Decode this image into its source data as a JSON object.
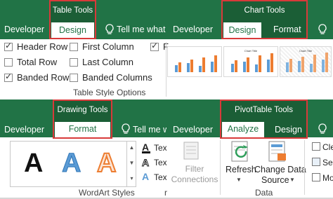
{
  "table_tools": {
    "context_title": "Table Tools",
    "tabs": {
      "left": "Developer",
      "active": "Design"
    },
    "tell_me": "Tell me what y",
    "options": {
      "col1": [
        {
          "label": "Header Row",
          "checked": true
        },
        {
          "label": "Total Row",
          "checked": false
        },
        {
          "label": "Banded Rows",
          "checked": true
        }
      ],
      "col2": [
        {
          "label": "First Column",
          "checked": false
        },
        {
          "label": "Last Column",
          "checked": false
        },
        {
          "label": "Banded Columns",
          "checked": false
        }
      ],
      "col3_partial": {
        "label": "F",
        "checked": true
      }
    },
    "group_label": "Table Style Options"
  },
  "chart_tools": {
    "context_title": "Chart Tools",
    "tabs": {
      "left": "Developer",
      "active": "Design",
      "right": "Format"
    },
    "style_thumbnails": [
      {
        "title": "",
        "style": "plain"
      },
      {
        "title": "Chart Title",
        "style": "plain"
      },
      {
        "title": "Chart Title",
        "style": "striped"
      }
    ]
  },
  "drawing_tools": {
    "context_title": "Drawing Tools",
    "tabs": {
      "left": "Developer",
      "active": "Format"
    },
    "tell_me": "Tell me w",
    "wordart_samples": [
      "A",
      "A",
      "A"
    ],
    "text_buttons": [
      "Tex",
      "Tex",
      "Tex"
    ],
    "group_label": "WordArt Styles",
    "group_label_partial": "er",
    "filter_connections": "Filter Connections"
  },
  "pivottable_tools": {
    "context_title": "PivotTable Tools",
    "tabs": {
      "left": "Developer",
      "active": "Analyze",
      "right": "Design"
    },
    "refresh_label": "Refresh",
    "change_source_line1": "Change Data",
    "change_source_line2": "Source",
    "group_label": "Data",
    "side_items": [
      "Cle",
      "Sel",
      "Mo"
    ]
  },
  "colors": {
    "ribbon_green": "#217346",
    "context_green": "#1b5e36",
    "highlight_red": "#d83a3a"
  }
}
